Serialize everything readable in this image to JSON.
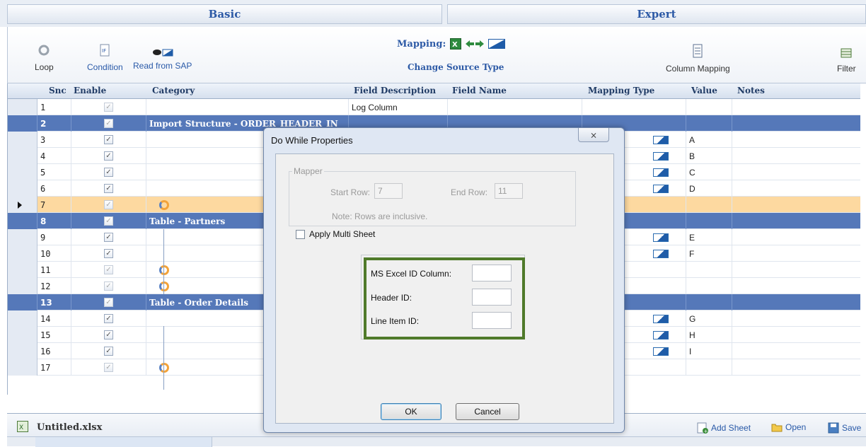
{
  "tabs": {
    "basic": "Basic",
    "expert": "Expert"
  },
  "ribbon": {
    "loop": "Loop",
    "condition": "Condition",
    "read_from_sap": "Read from SAP",
    "mapping": "Mapping:",
    "change_source_type": "Change Source Type",
    "column_mapping": "Column Mapping",
    "filter": "Filter"
  },
  "grid": {
    "headers": [
      "Snc",
      "Enable",
      "Category",
      "Field Description",
      "Field Name",
      "Mapping Type",
      "Value",
      "Notes"
    ],
    "rows": [
      {
        "sno": "1",
        "type": "normal",
        "enabled": false,
        "category": "",
        "field_description": "Log Column",
        "mapping": false,
        "value": ""
      },
      {
        "sno": "2",
        "type": "section",
        "enabled": false,
        "category": "Import Structure - ORDER_HEADER_IN",
        "field_description": "",
        "mapping": false,
        "value": ""
      },
      {
        "sno": "3",
        "type": "normal",
        "enabled": true,
        "category": "",
        "field_description": "",
        "mapping": true,
        "value": "A"
      },
      {
        "sno": "4",
        "type": "normal",
        "enabled": true,
        "category": "",
        "field_description": "",
        "mapping": true,
        "value": "B"
      },
      {
        "sno": "5",
        "type": "normal",
        "enabled": true,
        "category": "",
        "field_description": "",
        "mapping": true,
        "value": "C"
      },
      {
        "sno": "6",
        "type": "normal",
        "enabled": true,
        "category": "",
        "field_description": "",
        "mapping": true,
        "value": "D"
      },
      {
        "sno": "7",
        "type": "selected",
        "enabled": false,
        "category": "",
        "field_description": "",
        "mapping": false,
        "value": ""
      },
      {
        "sno": "8",
        "type": "section",
        "enabled": false,
        "category": "Table - Partners",
        "field_description": "",
        "mapping": false,
        "value": ""
      },
      {
        "sno": "9",
        "type": "normal",
        "enabled": true,
        "category": "",
        "field_description": "",
        "mapping": true,
        "value": "E"
      },
      {
        "sno": "10",
        "type": "normal",
        "enabled": true,
        "category": "",
        "field_description": "",
        "mapping": true,
        "value": "F"
      },
      {
        "sno": "11",
        "type": "normal",
        "enabled": false,
        "category": "",
        "field_description": "",
        "mapping": false,
        "value": ""
      },
      {
        "sno": "12",
        "type": "normal",
        "enabled": false,
        "category": "",
        "field_description": "",
        "mapping": false,
        "value": ""
      },
      {
        "sno": "13",
        "type": "section",
        "enabled": false,
        "category": "Table - Order Details",
        "field_description": "",
        "mapping": false,
        "value": ""
      },
      {
        "sno": "14",
        "type": "normal",
        "enabled": true,
        "category": "",
        "field_description": "",
        "mapping": true,
        "value": "G"
      },
      {
        "sno": "15",
        "type": "normal",
        "enabled": true,
        "category": "",
        "field_description": "",
        "mapping": true,
        "value": "H"
      },
      {
        "sno": "16",
        "type": "normal",
        "enabled": true,
        "category": "",
        "field_description": "",
        "mapping": true,
        "value": "I"
      },
      {
        "sno": "17",
        "type": "normal",
        "enabled": false,
        "category": "",
        "field_description": "",
        "mapping": false,
        "value": ""
      }
    ]
  },
  "bottom": {
    "file_name": "Untitled.xlsx",
    "add_sheet": "Add Sheet",
    "open": "Open",
    "save": "Save"
  },
  "dialog": {
    "title": "Do While Properties",
    "close": "⨯",
    "mapper_legend": "Mapper",
    "start_row_label": "Start Row:",
    "start_row_value": "7",
    "end_row_label": "End Row:",
    "end_row_value": "11",
    "note": "Note: Rows are inclusive.",
    "apply_multi_sheet": "Apply Multi Sheet",
    "ms_excel_id_column": "MS Excel ID Column:",
    "header_id": "Header ID:",
    "line_item_id": "Line Item ID:",
    "ok": "OK",
    "cancel": "Cancel"
  },
  "colors": {
    "section_row": "#5578b9",
    "selected_row": "#fdd9a0",
    "highlight_box": "#4f7a2a",
    "accent": "#2d5aa6"
  }
}
